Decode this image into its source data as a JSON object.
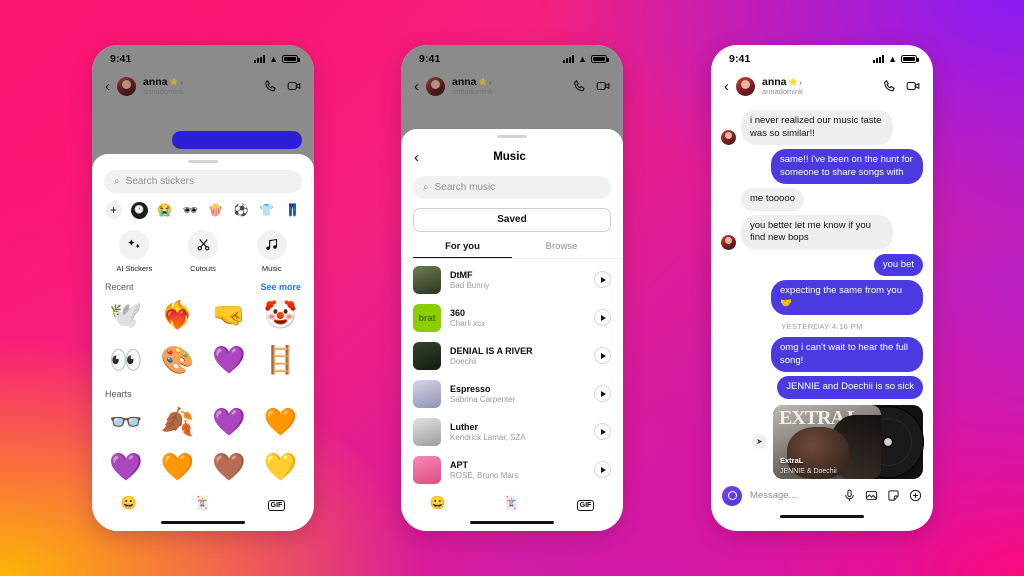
{
  "status_bar": {
    "time": "9:41",
    "icons": [
      "signal-icon",
      "wifi-icon",
      "battery-icon"
    ]
  },
  "phone_one": {
    "name": "stickers-sheet-screen",
    "chat_header": {
      "back": "‹",
      "name": "anna",
      "verified_badge": "🌟",
      "name_chevron": "›",
      "handle": "annadomink",
      "call_icon": "phone-icon",
      "video_icon": "video-icon"
    },
    "sheet": {
      "search_placeholder": "Search stickers",
      "search_icon": "search-icon",
      "categories": [
        {
          "name": "add-category",
          "glyph": "+"
        },
        {
          "name": "recent-category",
          "glyph": "🕐"
        },
        {
          "name": "crying-faces-sticker",
          "glyph": "😭"
        },
        {
          "name": "sunglasses-sticker",
          "glyph": "🕶"
        },
        {
          "name": "popcorn-sticker",
          "glyph": "🍿"
        },
        {
          "name": "soccer-sticker",
          "glyph": "⚽"
        },
        {
          "name": "shirt-sticker",
          "glyph": "👕"
        },
        {
          "name": "jeans-sticker",
          "glyph": "👖"
        }
      ],
      "quick_actions": [
        {
          "label": "AI Stickers",
          "icon": "ai-sparkle-icon"
        },
        {
          "label": "Cutouts",
          "icon": "scissors-icon"
        },
        {
          "label": "Music",
          "icon": "music-note-icon"
        }
      ],
      "recent": {
        "title": "Recent",
        "see_more": "See more",
        "stickers": [
          "🕊️",
          "❤️‍🔥",
          "🤜",
          "🤡",
          "👀",
          "🎨",
          "💜",
          "🪜"
        ]
      },
      "hearts": {
        "title": "Hearts",
        "stickers": [
          "👓",
          "🍂",
          "💜",
          "🧡",
          "💜",
          "🧡",
          "🤎",
          "💛"
        ]
      },
      "tabs": [
        {
          "name": "emoji-tab",
          "glyph": "😀"
        },
        {
          "name": "sticker-tab",
          "glyph": "🃏"
        },
        {
          "name": "gif-tab",
          "glyph": "GIF"
        }
      ]
    }
  },
  "phone_two": {
    "name": "music-picker-screen",
    "header": {
      "back": "‹",
      "title": "Music"
    },
    "search_placeholder": "Search music",
    "saved_label": "Saved",
    "tabs": [
      {
        "label": "For you",
        "active": true
      },
      {
        "label": "Browse",
        "active": false
      }
    ],
    "tracks": [
      {
        "title": "DtMF",
        "artist": "Bad Bunny",
        "art_text": "",
        "art_color": "#4c5c3c"
      },
      {
        "title": "360",
        "artist": "Charli xcx",
        "art_text": "brat",
        "art_color": "#8ACE00"
      },
      {
        "title": "DENIAL IS A RIVER",
        "artist": "Doechii",
        "art_text": "",
        "art_color": "#22301f"
      },
      {
        "title": "Espresso",
        "artist": "Sabrina Carpenter",
        "art_text": "",
        "art_color": "#b9c3d8"
      },
      {
        "title": "Luther",
        "artist": "Kendrick Lamar, SZA",
        "art_text": "",
        "art_color": "#d4d4d4"
      },
      {
        "title": "APT",
        "artist": "ROSÉ, Bruno Mars",
        "art_text": "",
        "art_color": "#f06a9a"
      }
    ],
    "play_icon": "play-icon",
    "tabs_bottom": [
      {
        "name": "emoji-tab",
        "glyph": "😀"
      },
      {
        "name": "sticker-tab",
        "glyph": "🃏"
      },
      {
        "name": "gif-tab",
        "glyph": "GIF"
      }
    ]
  },
  "phone_three": {
    "name": "conversation-screen",
    "chat_header": {
      "back": "‹",
      "name": "anna",
      "verified_badge": "🌟",
      "name_chevron": "›",
      "handle": "annadomink",
      "call_icon": "phone-icon",
      "video_icon": "video-icon"
    },
    "messages": [
      {
        "dir": "in",
        "text": "i never realized our music taste was so similar!!",
        "avatar": true
      },
      {
        "dir": "out",
        "text": "same!! i've been on the hunt for someone to share songs with"
      },
      {
        "dir": "in",
        "text": "me tooooo",
        "avatar": false
      },
      {
        "dir": "in",
        "text": "you better let me know if you find new bops",
        "avatar": true
      }
    ],
    "messages_out_short": [
      {
        "text": "you bet"
      },
      {
        "text": "expecting the same from you 🤝"
      }
    ],
    "day_stamp": "YESTERDAY 4:16 PM",
    "messages_after": [
      {
        "text": "omg i can't wait to hear the full song!"
      },
      {
        "text": "JENNIE and Doechii is so sick"
      }
    ],
    "shared_music": {
      "forward_icon": "forward-icon",
      "cover_word": "EXTRA L",
      "title": "ExtraL",
      "artist": "JENNIE & Doechii"
    },
    "composer": {
      "camera_icon": "camera-icon",
      "placeholder": "Message...",
      "icons": [
        {
          "name": "microphone-icon"
        },
        {
          "name": "photo-icon"
        },
        {
          "name": "sticker-icon"
        },
        {
          "name": "plus-circle-icon"
        }
      ]
    }
  },
  "colors": {
    "bubble_out": "#4A3AE0",
    "link": "#1878f3",
    "brat_green": "#8ACE00"
  }
}
